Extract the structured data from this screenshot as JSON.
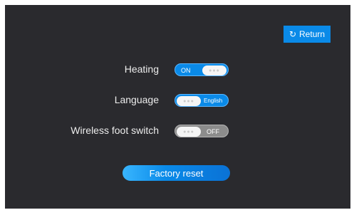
{
  "header": {
    "return_icon": "refresh-arrow-icon",
    "return_label": "Return"
  },
  "settings": [
    {
      "label": "Heating",
      "state": "ON",
      "style": "on"
    },
    {
      "label": "Language",
      "state": "English",
      "style": "on"
    },
    {
      "label": "Wireless foot switch",
      "state": "OFF",
      "style": "off"
    }
  ],
  "knob_glyph": "●●●",
  "actions": {
    "factory_reset_label": "Factory reset"
  },
  "colors": {
    "background": "#2a2a2e",
    "accent": "#0a8ae8",
    "toggle_off": "#8c8c8c"
  }
}
